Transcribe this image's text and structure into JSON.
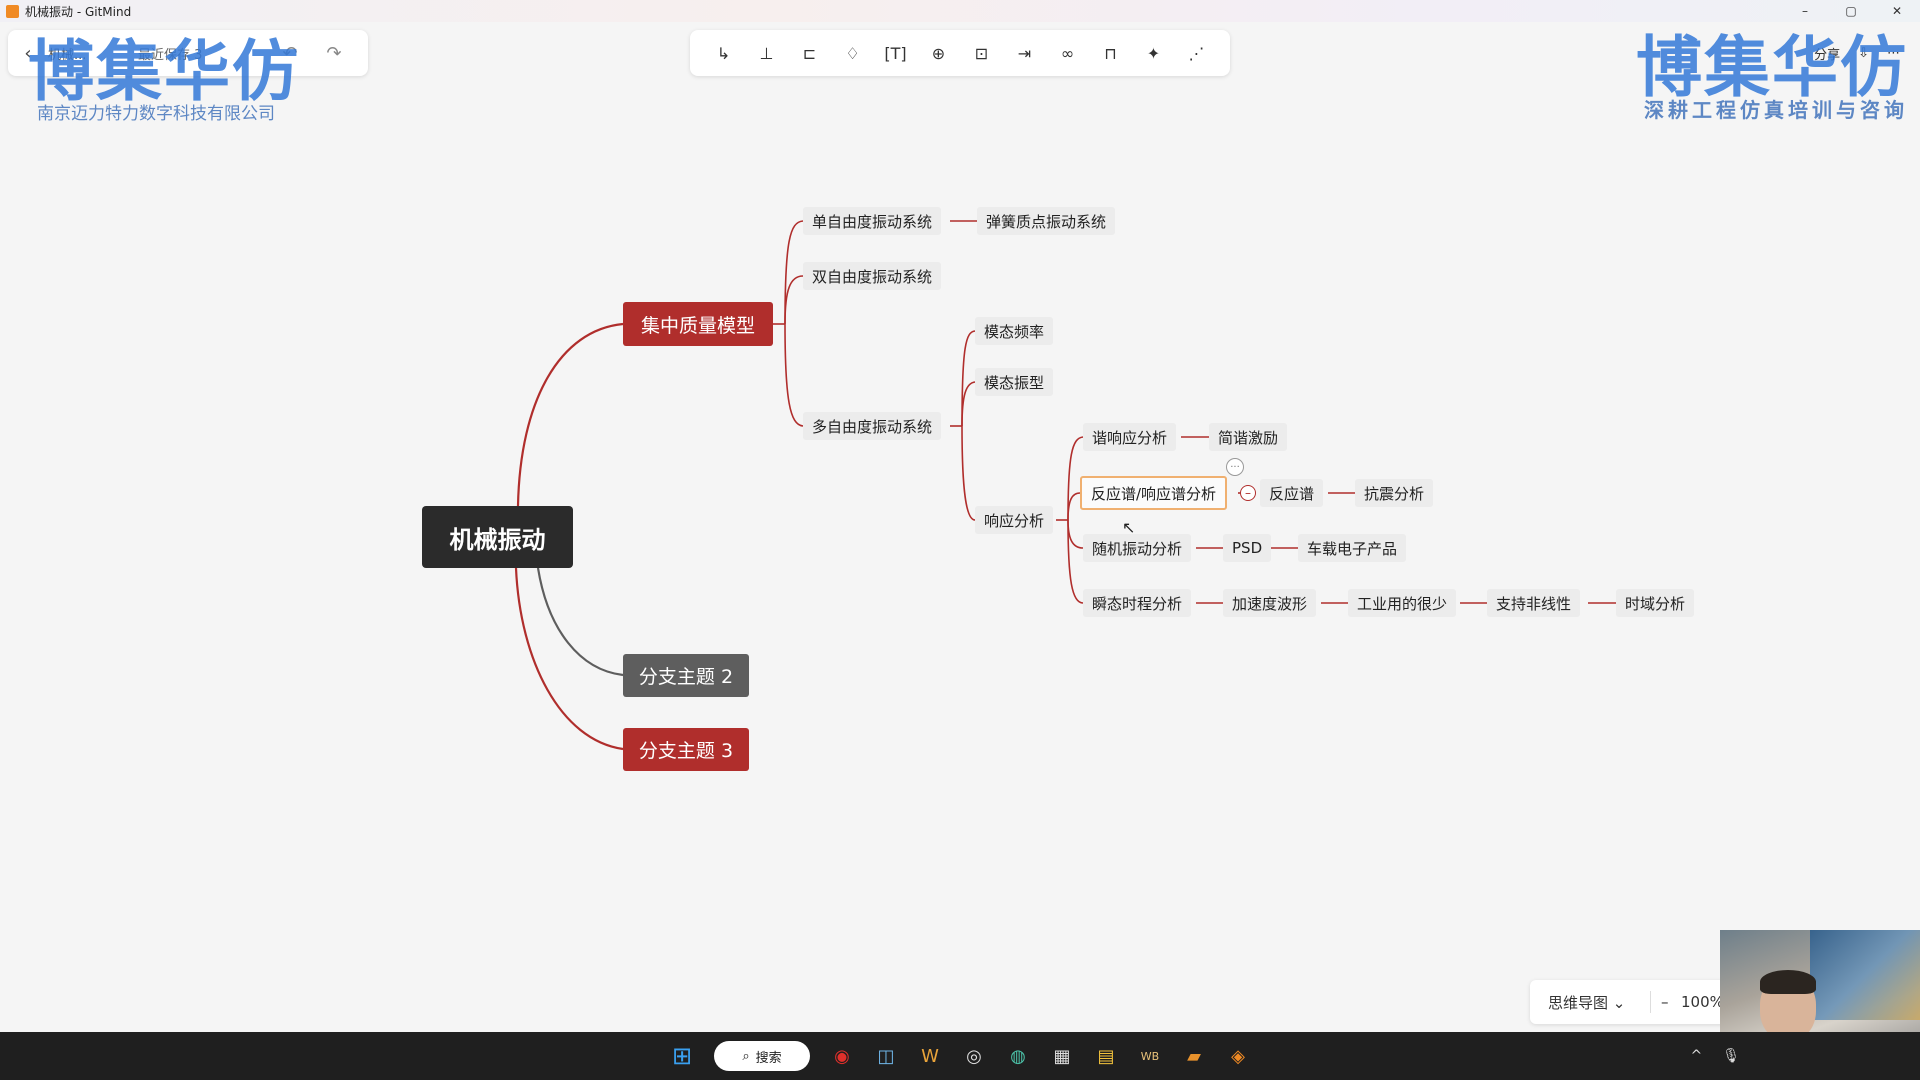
{
  "window": {
    "title": "机械振动 - GitMind",
    "controls": [
      "–",
      "▢",
      "✕"
    ]
  },
  "left_bar": {
    "back": "‹",
    "doc_name": "机械...",
    "save_status": "最近保存 3",
    "undo": "↶",
    "redo": "↷"
  },
  "toolbar": {
    "tools": [
      "↳",
      "⊥",
      "⊏",
      "♢",
      "[T]",
      "⊕",
      "⊡",
      "⇥",
      "∞",
      "⊓",
      "✦",
      "⋰"
    ]
  },
  "right_bar": {
    "share": "分享",
    "download_icon": "⇩",
    "more": "⋯"
  },
  "watermark": {
    "left_title": "博集华仿",
    "left_sub": "南京迈力特力数字科技有限公司",
    "right_title": "博集华仿",
    "right_sub": "深耕工程仿真培训与咨询"
  },
  "mindmap": {
    "root": "机械振动",
    "branch1": "集中质量模型",
    "branch2": "分支主题 2",
    "branch3": "分支主题 3",
    "n_sdof": "单自由度振动系统",
    "n_spring": "弹簧质点振动系统",
    "n_2dof": "双自由度振动系统",
    "n_mdof": "多自由度振动系统",
    "n_modefreq": "模态频率",
    "n_modeshape": "模态振型",
    "n_response": "响应分析",
    "n_harmonic": "谐响应分析",
    "n_simple": "简谐激励",
    "n_spectrum": "反应谱/响应谱分析",
    "n_resp_spec": "反应谱",
    "n_seismic": "抗震分析",
    "n_random": "随机振动分析",
    "n_psd": "PSD",
    "n_vehicle": "车载电子产品",
    "n_transient": "瞬态时程分析",
    "n_accel": "加速度波形",
    "n_industry": "工业用的很少",
    "n_nonlinear": "支持非线性",
    "n_timedomain": "时域分析",
    "collapse_symbol": "–",
    "comment_symbol": "···"
  },
  "zoom": {
    "mode": "思维导图 ⌄",
    "minus": "–",
    "value": "100%"
  },
  "taskbar": {
    "search": "搜索",
    "apps": [
      "⊞",
      "◉",
      "◫",
      "W",
      "◎",
      "◍",
      "▦",
      "▤",
      "WB",
      "▰",
      "◈"
    ],
    "tray": [
      "^",
      "🎙"
    ]
  },
  "colors": {
    "branch_red": "#b02e2c",
    "root_dark": "#2b2b2b",
    "branch_grey": "#5e5e5e",
    "watermark_blue": "#3278d7"
  }
}
